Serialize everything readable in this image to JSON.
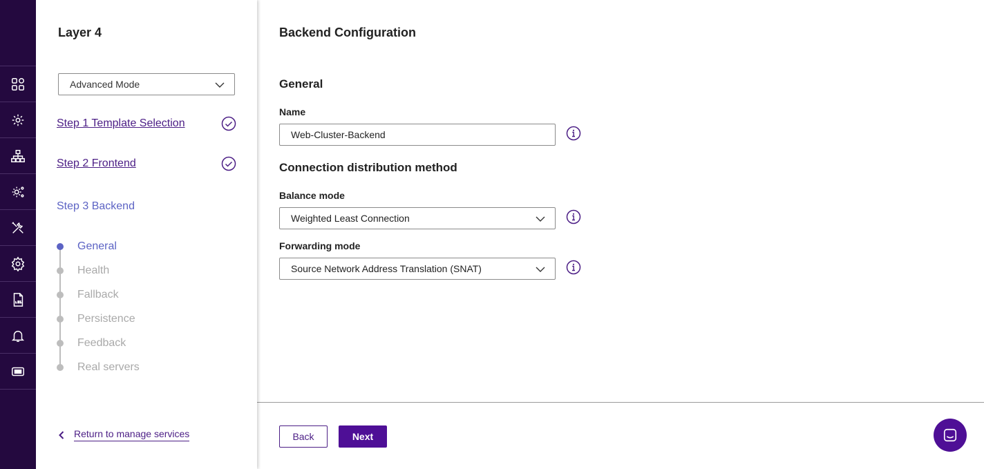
{
  "sidebar_rail": {
    "icons": [
      "dashboard-icon",
      "virtual-services-icon",
      "network-icon",
      "system-config-icon",
      "tools-icon",
      "settings-icon",
      "log-file-icon",
      "notifications-icon",
      "ticket-icon"
    ],
    "colors": {
      "background": "#24093f",
      "icon": "#ffffff"
    }
  },
  "wizard": {
    "title": "Layer 4",
    "mode_select": {
      "value": "Advanced Mode"
    },
    "steps": [
      {
        "label": "Step 1 Template Selection",
        "completed": true
      },
      {
        "label": "Step 2 Frontend",
        "completed": true
      },
      {
        "label": "Step 3 Backend",
        "current": true
      }
    ],
    "substeps": [
      {
        "label": "General",
        "active": true
      },
      {
        "label": "Health",
        "active": false
      },
      {
        "label": "Fallback",
        "active": false
      },
      {
        "label": "Persistence",
        "active": false
      },
      {
        "label": "Feedback",
        "active": false
      },
      {
        "label": "Real servers",
        "active": false
      }
    ],
    "return_link": "Return to manage services"
  },
  "main": {
    "title": "Backend Configuration",
    "general": {
      "heading": "General",
      "name_label": "Name",
      "name_value": "Web-Cluster-Backend"
    },
    "distribution": {
      "heading": "Connection distribution method",
      "balance_label": "Balance mode",
      "balance_value": "Weighted Least Connection",
      "forwarding_label": "Forwarding mode",
      "forwarding_value": "Source Network Address Translation (SNAT)"
    },
    "buttons": {
      "back": "Back",
      "next": "Next"
    }
  },
  "colors": {
    "accent": "#4e0f96",
    "link": "#4b1d85",
    "active_step": "#5c63c4",
    "inactive_step": "#a9a9a9"
  }
}
